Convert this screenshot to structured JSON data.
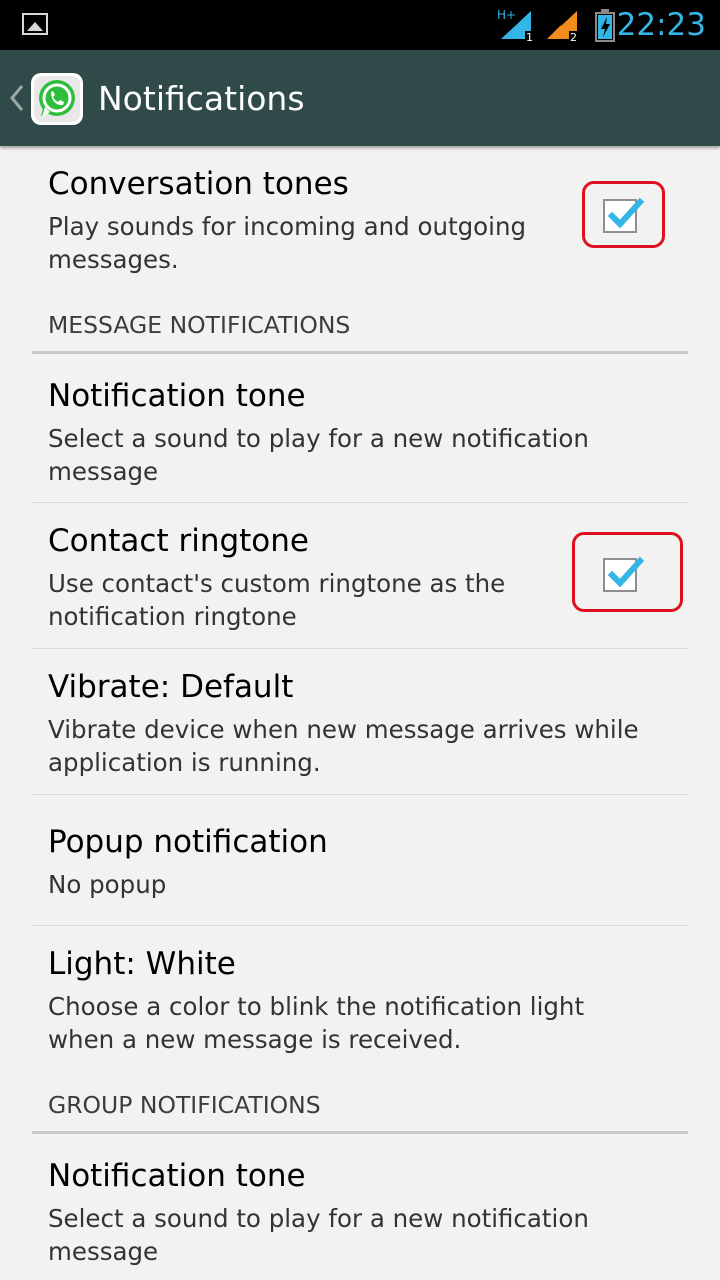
{
  "status_bar": {
    "time": "22:23",
    "network_label": "H+",
    "sim1_label": "1",
    "sim2_label": "2",
    "accent_color": "#33b5e5"
  },
  "action_bar": {
    "title": "Notifications",
    "background_color": "#2f4a48"
  },
  "settings": {
    "conversation_tones": {
      "title": "Conversation tones",
      "summary_line1": "Play sounds for incoming and outgoing",
      "summary_line2": "messages.",
      "checked": true
    },
    "message_notifications_header": "MESSAGE NOTIFICATIONS",
    "notification_tone": {
      "title": "Notification tone",
      "summary_line1": "Select a sound to play for a new notification",
      "summary_line2": "message"
    },
    "contact_ringtone": {
      "title": "Contact ringtone",
      "summary_line1": "Use contact's custom ringtone as the",
      "summary_line2": "notification ringtone",
      "checked": true
    },
    "vibrate": {
      "title": "Vibrate: Default",
      "summary_line1": "Vibrate device when new message arrives while",
      "summary_line2": "application is running."
    },
    "popup_notification": {
      "title": "Popup notification",
      "summary_line1": "No popup"
    },
    "light": {
      "title": "Light: White",
      "summary_line1": "Choose a color to blink the notification light",
      "summary_line2": "when a new message is received."
    },
    "group_notifications_header": "GROUP NOTIFICATIONS",
    "group_notification_tone": {
      "title": "Notification tone",
      "summary_line1": "Select a sound to play for a new notification",
      "summary_line2": "message"
    }
  },
  "colors": {
    "checkmark": "#33b5e5",
    "highlight": "#e0101e"
  },
  "icons": [
    "gallery-icon",
    "signal-icon",
    "battery-icon",
    "back-chevron-icon",
    "whatsapp-logo-icon",
    "checkmark-icon"
  ]
}
